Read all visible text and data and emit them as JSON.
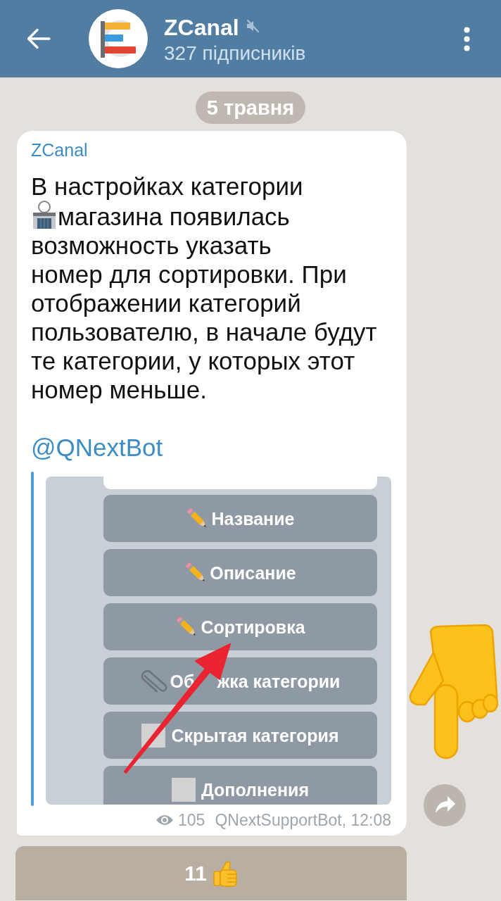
{
  "header": {
    "title": "ZCanal",
    "muted": true,
    "subtitle": "327 підписників"
  },
  "date_pill": "5 травня",
  "message": {
    "sender": "ZCanal",
    "text_lines": [
      {
        "kind": "plain",
        "text": "В настройках категории"
      },
      {
        "kind": "emoji",
        "text": "магазина появилась"
      },
      {
        "kind": "plain",
        "text": "возможность указать"
      },
      {
        "kind": "plain",
        "text": "номер для сортировки. При"
      },
      {
        "kind": "plain",
        "text": "отображении категорий"
      },
      {
        "kind": "plain",
        "text": "пользователю, в начале будут"
      },
      {
        "kind": "plain",
        "text": "те категории, у которых этот"
      },
      {
        "kind": "plain",
        "text": "номер меньше."
      }
    ],
    "link": "@QNextBot",
    "screenshot": {
      "buttons": [
        {
          "kind": "edit",
          "label_parts": [
            "Название"
          ]
        },
        {
          "kind": "edit",
          "label_parts": [
            "Описание"
          ]
        },
        {
          "kind": "edit",
          "label_parts": [
            "Сортировка"
          ]
        },
        {
          "kind": "attach",
          "label_parts": [
            "Об",
            "жка категории"
          ]
        },
        {
          "kind": "toggle",
          "label_parts": [
            "Скрытая категория"
          ]
        },
        {
          "kind": "toggle",
          "label_parts": [
            "Дополнения"
          ]
        }
      ]
    },
    "views": "105",
    "signature": "QNextSupportBot, 12:08"
  },
  "reaction": {
    "count": "11"
  }
}
